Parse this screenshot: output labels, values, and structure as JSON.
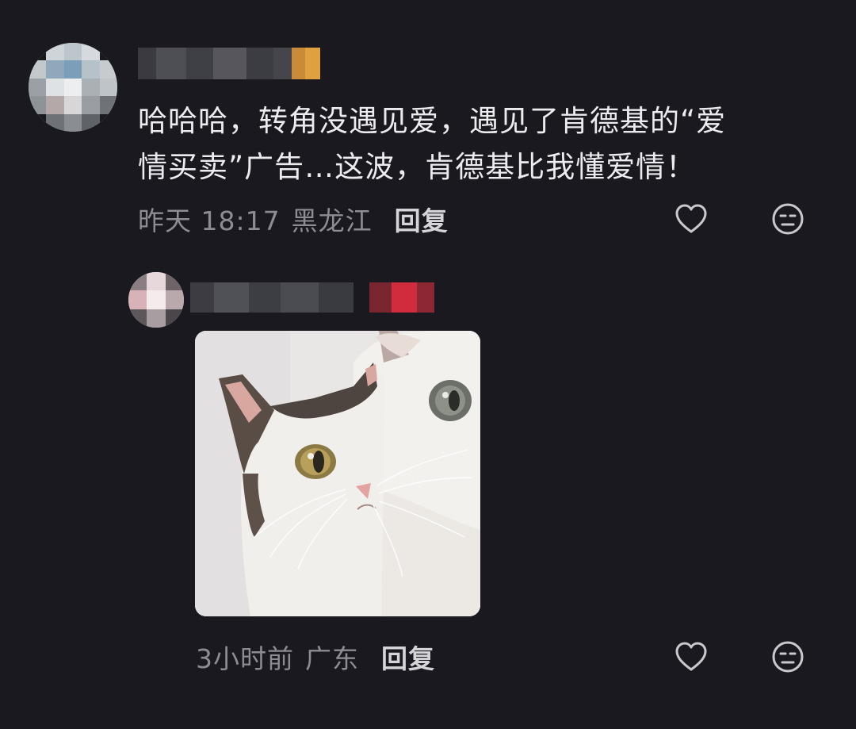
{
  "comment": {
    "author_name": "",
    "text_line1": "哈哈哈，转角没遇见爱，遇见了肯德基的“爱",
    "text_line2": "情买卖”广告…这波，肯德基比我懂爱情！",
    "time": "昨天 18:17",
    "location": "黑龙江",
    "reply_label": "回复"
  },
  "reply": {
    "author_name": "",
    "time": "3小时前",
    "location": "广东",
    "reply_label": "回复"
  },
  "icons": {
    "like": "heart-outline-icon",
    "dislike": "meh-face-icon"
  },
  "colors": {
    "background": "#1a191f",
    "text_primary": "#ececee",
    "text_secondary": "#8d8c92",
    "reply_label": "#d5d5d8"
  }
}
